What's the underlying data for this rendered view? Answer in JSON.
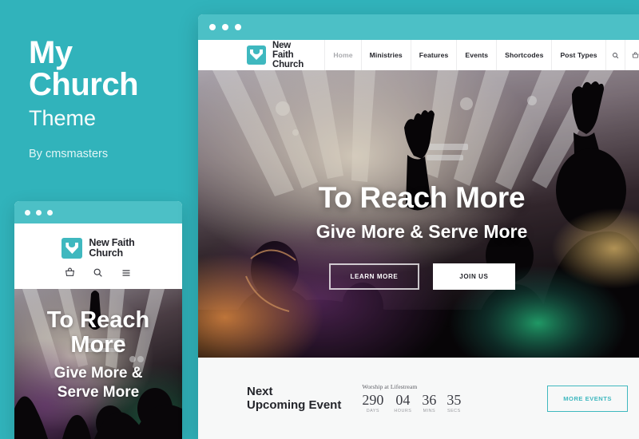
{
  "promo": {
    "title_line1": "My",
    "title_line2": "Church",
    "subtitle": "Theme",
    "author": "By cmsmasters"
  },
  "colors": {
    "brand_teal": "#31b3bb",
    "chrome_teal": "#4cc0c6",
    "logo_teal": "#3fb8bf",
    "dark_text": "#24252b",
    "strip_bg": "#f7f8f8"
  },
  "desktop": {
    "window_dots": 3,
    "logo": {
      "icon": "heart-shield-icon",
      "line1": "New Faith",
      "line2": "Church"
    },
    "nav": [
      {
        "label": "Home",
        "active": true
      },
      {
        "label": "Ministries",
        "active": false
      },
      {
        "label": "Features",
        "active": false
      },
      {
        "label": "Events",
        "active": false
      },
      {
        "label": "Shortcodes",
        "active": false
      },
      {
        "label": "Post Types",
        "active": false
      }
    ],
    "nav_icons": [
      {
        "name": "search-icon"
      },
      {
        "name": "basket-icon"
      }
    ],
    "hero": {
      "heading": "To Reach More",
      "subheading": "Give More & Serve More",
      "primary_button": "LEARN MORE",
      "secondary_button": "JOIN US"
    },
    "event": {
      "title_line1": "Next",
      "title_line2": "Upcoming Event",
      "event_name": "Worship at Lifestream",
      "countdown": [
        {
          "value": "290",
          "unit": "DAYS"
        },
        {
          "value": "04",
          "unit": "HOURS"
        },
        {
          "value": "36",
          "unit": "MINS"
        },
        {
          "value": "35",
          "unit": "SECS"
        }
      ],
      "more_button": "MORE EVENTS"
    }
  },
  "mobile": {
    "window_dots": 3,
    "logo": {
      "icon": "heart-shield-icon",
      "line1": "New Faith",
      "line2": "Church"
    },
    "icons": [
      {
        "name": "basket-icon"
      },
      {
        "name": "search-icon"
      },
      {
        "name": "hamburger-menu-icon"
      }
    ],
    "hero": {
      "heading_line1": "To Reach",
      "heading_line2": "More",
      "subheading_line1": "Give More &",
      "subheading_line2": "Serve More"
    }
  }
}
